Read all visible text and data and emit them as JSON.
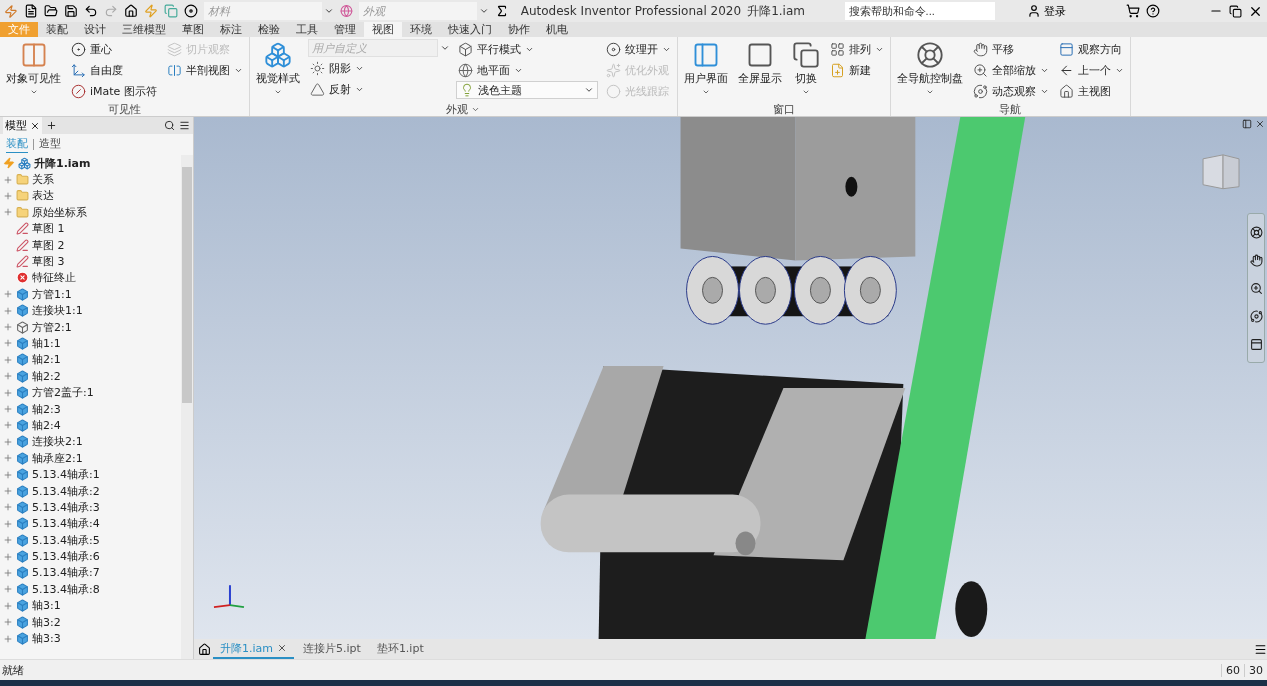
{
  "quick_access": {
    "material_field": {
      "placeholder": "材料"
    },
    "appearance_field": {
      "placeholder": "外观"
    }
  },
  "window": {
    "title": "Autodesk Inventor Professional 2020",
    "document": "升降1.iam"
  },
  "search": {
    "placeholder": "搜索帮助和命令..."
  },
  "account": {
    "label": "登录"
  },
  "ribbon_tabs": [
    {
      "label": "文件",
      "kind": "file",
      "selected": false
    },
    {
      "label": "装配",
      "kind": "tab",
      "selected": false
    },
    {
      "label": "设计",
      "kind": "tab",
      "selected": false
    },
    {
      "label": "三维模型",
      "kind": "tab",
      "selected": false
    },
    {
      "label": "草图",
      "kind": "tab",
      "selected": false
    },
    {
      "label": "标注",
      "kind": "tab",
      "selected": false
    },
    {
      "label": "检验",
      "kind": "tab",
      "selected": false
    },
    {
      "label": "工具",
      "kind": "tab",
      "selected": false
    },
    {
      "label": "管理",
      "kind": "tab",
      "selected": false
    },
    {
      "label": "视图",
      "kind": "tab",
      "selected": true
    },
    {
      "label": "环境",
      "kind": "tab",
      "selected": false
    },
    {
      "label": "快速入门",
      "kind": "tab",
      "selected": false
    },
    {
      "label": "协作",
      "kind": "tab",
      "selected": false
    },
    {
      "label": "机电",
      "kind": "tab",
      "selected": false
    }
  ],
  "ribbon_panels": [
    {
      "title": "可见性",
      "columns": [
        [
          {
            "label": "对象可见性",
            "kind": "large",
            "disabled": false,
            "menu": true
          }
        ],
        [
          {
            "label": "重心",
            "kind": "small",
            "disabled": false,
            "menu": false
          },
          {
            "label": "自由度",
            "kind": "small",
            "disabled": false,
            "menu": false
          },
          {
            "label": "iMate 图示符",
            "kind": "small",
            "disabled": false,
            "menu": false
          }
        ],
        [
          {
            "label": "切片观察",
            "kind": "small",
            "disabled": true,
            "menu": false
          },
          {
            "label": "半剖视图",
            "kind": "small",
            "disabled": false,
            "menu": true
          }
        ]
      ]
    },
    {
      "title": "外观",
      "title_menu": true,
      "columns": [
        [
          {
            "label": "视觉样式",
            "kind": "large",
            "disabled": false,
            "menu": true
          }
        ],
        [
          {
            "placeholder": "用户自定义",
            "kind": "select",
            "disabled": true
          },
          {
            "label": "阴影",
            "kind": "small",
            "disabled": false,
            "menu": true
          },
          {
            "label": "反射",
            "kind": "small",
            "disabled": false,
            "menu": true
          }
        ],
        [
          {
            "label": "平行模式",
            "kind": "small",
            "disabled": false,
            "menu": true
          },
          {
            "label": "地平面",
            "kind": "small",
            "disabled": false,
            "menu": true
          },
          {
            "label": "浅色主题",
            "kind": "select-icon",
            "disabled": false
          }
        ],
        [
          {
            "label": "纹理开",
            "kind": "small",
            "disabled": false,
            "menu": true
          },
          {
            "label": "优化外观",
            "kind": "small",
            "disabled": true,
            "menu": false
          },
          {
            "label": "光线跟踪",
            "kind": "small",
            "disabled": true,
            "menu": false
          }
        ]
      ]
    },
    {
      "title": "窗口",
      "columns": [
        [
          {
            "label": "用户界面",
            "kind": "large",
            "disabled": false,
            "menu": true
          }
        ],
        [
          {
            "label": "全屏显示",
            "kind": "large",
            "disabled": false,
            "menu": false
          }
        ],
        [
          {
            "label": "切换",
            "kind": "large",
            "disabled": false,
            "menu": true
          }
        ],
        [
          {
            "label": "排列",
            "kind": "small",
            "disabled": false,
            "menu": true
          },
          {
            "label": "新建",
            "kind": "small",
            "disabled": false,
            "menu": false
          }
        ]
      ]
    },
    {
      "title": "导航",
      "columns": [
        [
          {
            "label": "全导航控制盘",
            "kind": "large",
            "disabled": false,
            "menu": true
          }
        ],
        [
          {
            "label": "平移",
            "kind": "small",
            "disabled": false,
            "menu": false
          },
          {
            "label": "全部缩放",
            "kind": "small",
            "disabled": false,
            "menu": true
          },
          {
            "label": "动态观察",
            "kind": "small",
            "disabled": false,
            "menu": true
          }
        ],
        [
          {
            "label": "观察方向",
            "kind": "small",
            "disabled": false,
            "menu": false
          },
          {
            "label": "上一个",
            "kind": "small",
            "disabled": false,
            "menu": true
          },
          {
            "label": "主视图",
            "kind": "small",
            "disabled": false,
            "menu": false
          }
        ]
      ]
    }
  ],
  "browser": {
    "tab": "模型",
    "modes": [
      {
        "label": "装配",
        "selected": true
      },
      {
        "label": "造型",
        "selected": false
      }
    ],
    "root": {
      "label": "升降1.iam",
      "kind": "assembly"
    },
    "items": [
      {
        "label": "关系",
        "kind": "folder",
        "expandable": true
      },
      {
        "label": "表达",
        "kind": "folder",
        "expandable": true
      },
      {
        "label": "原始坐标系",
        "kind": "folder",
        "expandable": true
      },
      {
        "label": "草图 1",
        "kind": "sketch",
        "expandable": false
      },
      {
        "label": "草图 2",
        "kind": "sketch",
        "expandable": false
      },
      {
        "label": "草图 3",
        "kind": "sketch",
        "expandable": false
      },
      {
        "label": "特征终止",
        "kind": "stop",
        "expandable": false
      },
      {
        "label": "方管1:1",
        "kind": "part",
        "expandable": true
      },
      {
        "label": "连接块1:1",
        "kind": "part",
        "expandable": true
      },
      {
        "label": "方管2:1",
        "kind": "wire",
        "expandable": true
      },
      {
        "label": "轴1:1",
        "kind": "part",
        "expandable": true
      },
      {
        "label": "轴2:1",
        "kind": "part",
        "expandable": true
      },
      {
        "label": "轴2:2",
        "kind": "part",
        "expandable": true
      },
      {
        "label": "方管2盖子:1",
        "kind": "part",
        "expandable": true
      },
      {
        "label": "轴2:3",
        "kind": "part",
        "expandable": true
      },
      {
        "label": "轴2:4",
        "kind": "part",
        "expandable": true
      },
      {
        "label": "连接块2:1",
        "kind": "part",
        "expandable": true
      },
      {
        "label": "轴承座2:1",
        "kind": "part",
        "expandable": true
      },
      {
        "label": "5.13.4轴承:1",
        "kind": "part",
        "expandable": true
      },
      {
        "label": "5.13.4轴承:2",
        "kind": "part",
        "expandable": true
      },
      {
        "label": "5.13.4轴承:3",
        "kind": "part",
        "expandable": true
      },
      {
        "label": "5.13.4轴承:4",
        "kind": "part",
        "expandable": true
      },
      {
        "label": "5.13.4轴承:5",
        "kind": "part",
        "expandable": true
      },
      {
        "label": "5.13.4轴承:6",
        "kind": "part",
        "expandable": true
      },
      {
        "label": "5.13.4轴承:7",
        "kind": "part",
        "expandable": true
      },
      {
        "label": "5.13.4轴承:8",
        "kind": "part",
        "expandable": true
      },
      {
        "label": "轴3:1",
        "kind": "part",
        "expandable": true
      },
      {
        "label": "轴3:2",
        "kind": "part",
        "expandable": true
      },
      {
        "label": "轴3:3",
        "kind": "part",
        "expandable": true
      }
    ]
  },
  "document_tabs": [
    {
      "label": "升降1.iam",
      "selected": true
    },
    {
      "label": "连接片5.ipt",
      "selected": false
    },
    {
      "label": "垫环1.ipt",
      "selected": false
    }
  ],
  "status_bar": {
    "message": "就绪",
    "values": [
      "60",
      "30"
    ]
  }
}
